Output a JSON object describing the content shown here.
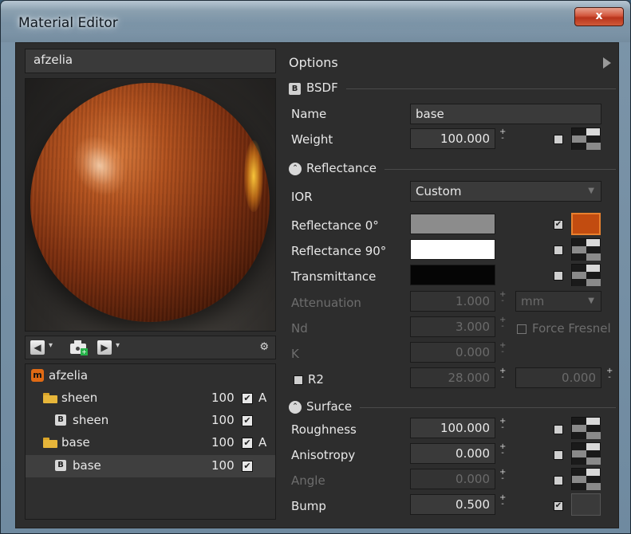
{
  "window": {
    "title": "Material Editor",
    "close_label": "x"
  },
  "material_name": "afzelia",
  "tree": {
    "items": [
      {
        "icon": "material",
        "badge": "m",
        "label": "afzelia",
        "value": "",
        "checked": false,
        "flag": ""
      },
      {
        "icon": "folder",
        "badge": "",
        "label": "sheen",
        "value": "100",
        "checked": true,
        "flag": "A"
      },
      {
        "icon": "bsdf",
        "badge": "B",
        "label": "sheen",
        "value": "100",
        "checked": true,
        "flag": ""
      },
      {
        "icon": "folder",
        "badge": "",
        "label": "base",
        "value": "100",
        "checked": true,
        "flag": "A"
      },
      {
        "icon": "bsdf",
        "badge": "B",
        "label": "base",
        "value": "100",
        "checked": true,
        "flag": ""
      }
    ]
  },
  "options": {
    "label": "Options"
  },
  "bsdf": {
    "section_label": "BSDF",
    "badge": "B",
    "name_label": "Name",
    "name_value": "base",
    "weight_label": "Weight",
    "weight_value": "100.000"
  },
  "reflectance": {
    "section_label": "Reflectance",
    "ior_label": "IOR",
    "ior_value": "Custom",
    "refl0_label": "Reflectance 0°",
    "refl90_label": "Reflectance 90°",
    "transmittance_label": "Transmittance",
    "attenuation_label": "Attenuation",
    "attenuation_value": "1.000",
    "attenuation_unit": "mm",
    "nd_label": "Nd",
    "nd_value": "3.000",
    "force_fresnel_label": "Force Fresnel",
    "k_label": "K",
    "k_value": "0.000",
    "r2_label": "R2",
    "r2_value": "28.000",
    "r2_value2": "0.000",
    "colors": {
      "refl0": "#8c8c8c",
      "refl90": "#ffffff",
      "transmittance": "#050505",
      "refl0_texture": "#c24c10"
    }
  },
  "surface": {
    "section_label": "Surface",
    "roughness_label": "Roughness",
    "roughness_value": "100.000",
    "anisotropy_label": "Anisotropy",
    "anisotropy_value": "0.000",
    "angle_label": "Angle",
    "angle_value": "0.000",
    "bump_label": "Bump",
    "bump_value": "0.500"
  },
  "spinner": {
    "up": "+",
    "down": "-"
  },
  "check": "✔"
}
